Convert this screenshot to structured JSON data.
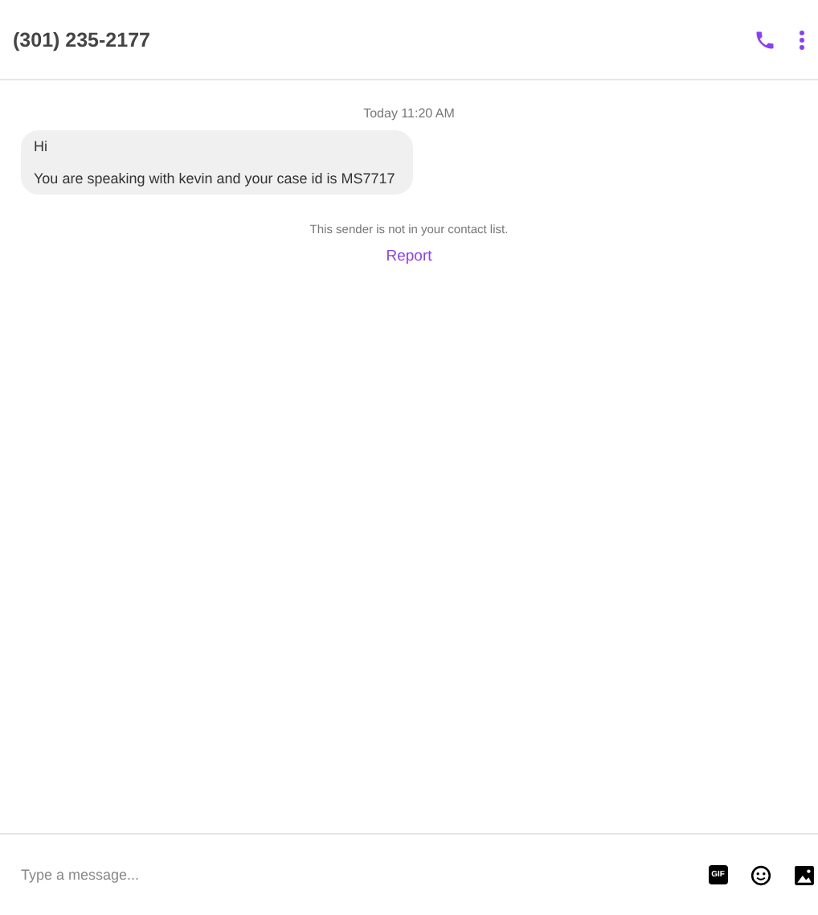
{
  "header": {
    "title": "(301) 235-2177"
  },
  "timestamp": "Today 11:20 AM",
  "messages": [
    {
      "lines": [
        "Hi",
        "You are speaking with kevin and your case id is MS7717"
      ]
    }
  ],
  "notice": {
    "text": "This sender is not in your contact list.",
    "link": "Report"
  },
  "composer": {
    "placeholder": "Type a message...",
    "gif_label": "GIF"
  }
}
